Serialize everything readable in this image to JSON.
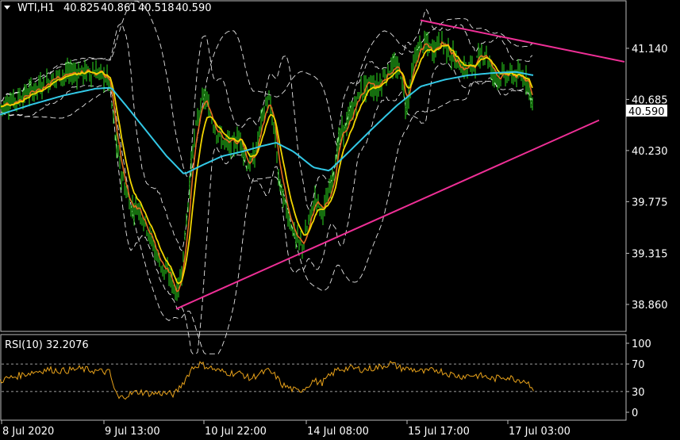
{
  "header": {
    "symbol": "WTI,H1",
    "open": "40.825",
    "high": "40.861",
    "low": "40.518",
    "close": "40.590"
  },
  "rsi": {
    "label": "RSI(10) 32.2076"
  },
  "colors": {
    "background": "#000000",
    "candles": "#2bdc1e",
    "ma_fast": "#e06b1f",
    "ma_mid": "#f2d500",
    "ma_slow": "#32c8e6",
    "bands": "#e6e6e6",
    "trendlines": "#ee2f96",
    "rsi_line": "#e8a21a",
    "price_tag_bg": "#ffffff",
    "price_tag_text": "#000000"
  },
  "chart_data": [
    {
      "type": "line",
      "title": "WTI,H1",
      "y_ticks": [
        "41.140",
        "40.685",
        "40.230",
        "39.775",
        "39.315",
        "38.860"
      ],
      "x_ticks": [
        "8 Jul 2020",
        "9 Jul 13:00",
        "10 Jul 22:00",
        "14 Jul 08:00",
        "15 Jul 17:00",
        "17 Jul 03:00"
      ],
      "current_price": "40.590",
      "ylim": [
        38.62,
        41.57
      ],
      "price_path": [
        [
          0,
          40.62
        ],
        [
          25,
          40.7
        ],
        [
          50,
          40.8
        ],
        [
          75,
          40.9
        ],
        [
          100,
          40.93
        ],
        [
          125,
          40.92
        ],
        [
          138,
          40.85
        ],
        [
          145,
          40.35
        ],
        [
          155,
          39.95
        ],
        [
          165,
          39.72
        ],
        [
          175,
          39.72
        ],
        [
          185,
          39.55
        ],
        [
          195,
          39.35
        ],
        [
          205,
          39.18
        ],
        [
          215,
          39.1
        ],
        [
          222,
          38.95
        ],
        [
          228,
          39.1
        ],
        [
          235,
          39.6
        ],
        [
          243,
          40.25
        ],
        [
          250,
          40.55
        ],
        [
          258,
          40.72
        ],
        [
          265,
          40.55
        ],
        [
          273,
          40.4
        ],
        [
          283,
          40.3
        ],
        [
          293,
          40.28
        ],
        [
          303,
          40.35
        ],
        [
          312,
          40.08
        ],
        [
          322,
          40.2
        ],
        [
          330,
          40.52
        ],
        [
          338,
          40.7
        ],
        [
          345,
          40.45
        ],
        [
          352,
          39.95
        ],
        [
          360,
          39.72
        ],
        [
          368,
          39.55
        ],
        [
          375,
          39.42
        ],
        [
          382,
          39.38
        ],
        [
          390,
          39.62
        ],
        [
          398,
          39.82
        ],
        [
          405,
          39.68
        ],
        [
          413,
          39.8
        ],
        [
          420,
          40.02
        ],
        [
          428,
          40.35
        ],
        [
          436,
          40.45
        ],
        [
          445,
          40.6
        ],
        [
          455,
          40.76
        ],
        [
          465,
          40.82
        ],
        [
          475,
          40.78
        ],
        [
          485,
          40.9
        ],
        [
          495,
          40.98
        ],
        [
          505,
          40.92
        ],
        [
          512,
          40.6
        ],
        [
          520,
          40.95
        ],
        [
          528,
          41.15
        ],
        [
          536,
          41.18
        ],
        [
          545,
          41.12
        ],
        [
          555,
          41.22
        ],
        [
          565,
          41.12
        ],
        [
          575,
          41.02
        ],
        [
          585,
          40.95
        ],
        [
          595,
          40.98
        ],
        [
          605,
          41.05
        ],
        [
          612,
          41.12
        ],
        [
          620,
          40.92
        ],
        [
          628,
          40.88
        ],
        [
          638,
          40.9
        ],
        [
          648,
          40.9
        ],
        [
          658,
          40.88
        ],
        [
          666,
          40.86
        ],
        [
          672,
          40.59
        ]
      ],
      "ma_slow_path": [
        [
          0,
          40.55
        ],
        [
          40,
          40.64
        ],
        [
          80,
          40.72
        ],
        [
          120,
          40.78
        ],
        [
          140,
          40.79
        ],
        [
          160,
          40.62
        ],
        [
          185,
          40.4
        ],
        [
          210,
          40.18
        ],
        [
          232,
          40.02
        ],
        [
          255,
          40.1
        ],
        [
          280,
          40.18
        ],
        [
          305,
          40.22
        ],
        [
          330,
          40.27
        ],
        [
          348,
          40.3
        ],
        [
          370,
          40.22
        ],
        [
          395,
          40.08
        ],
        [
          415,
          40.05
        ],
        [
          440,
          40.22
        ],
        [
          470,
          40.43
        ],
        [
          500,
          40.63
        ],
        [
          530,
          40.8
        ],
        [
          560,
          40.86
        ],
        [
          590,
          40.9
        ],
        [
          620,
          40.92
        ],
        [
          650,
          40.93
        ],
        [
          672,
          40.9
        ]
      ],
      "trendlines": [
        {
          "from": [
            222,
            38.82
          ],
          "to": [
            755,
            40.5
          ]
        },
        {
          "from": [
            530,
            41.39
          ],
          "to": [
            787,
            41.02
          ]
        }
      ]
    },
    {
      "type": "line",
      "title": "RSI(10) 32.2076",
      "y_ticks": [
        "100",
        "70",
        "30",
        "0"
      ],
      "levels": [
        70,
        30
      ],
      "ylim": [
        0,
        100
      ],
      "value": 32.2076,
      "rsi_path": [
        [
          0,
          46
        ],
        [
          20,
          52
        ],
        [
          40,
          58
        ],
        [
          60,
          62
        ],
        [
          80,
          60
        ],
        [
          100,
          63
        ],
        [
          120,
          60
        ],
        [
          138,
          58
        ],
        [
          145,
          30
        ],
        [
          150,
          20
        ],
        [
          160,
          25
        ],
        [
          175,
          30
        ],
        [
          190,
          27
        ],
        [
          205,
          28
        ],
        [
          220,
          26
        ],
        [
          232,
          45
        ],
        [
          242,
          64
        ],
        [
          252,
          70
        ],
        [
          262,
          66
        ],
        [
          275,
          60
        ],
        [
          290,
          57
        ],
        [
          305,
          56
        ],
        [
          315,
          48
        ],
        [
          325,
          55
        ],
        [
          338,
          60
        ],
        [
          348,
          52
        ],
        [
          355,
          40
        ],
        [
          365,
          35
        ],
        [
          375,
          30
        ],
        [
          385,
          36
        ],
        [
          395,
          46
        ],
        [
          405,
          42
        ],
        [
          415,
          52
        ],
        [
          425,
          62
        ],
        [
          440,
          64
        ],
        [
          460,
          62
        ],
        [
          480,
          66
        ],
        [
          492,
          71
        ],
        [
          505,
          64
        ],
        [
          520,
          62
        ],
        [
          535,
          58
        ],
        [
          550,
          62
        ],
        [
          565,
          56
        ],
        [
          580,
          52
        ],
        [
          595,
          54
        ],
        [
          610,
          52
        ],
        [
          622,
          48
        ],
        [
          635,
          52
        ],
        [
          650,
          48
        ],
        [
          662,
          46
        ],
        [
          668,
          40
        ],
        [
          672,
          32
        ]
      ]
    }
  ]
}
